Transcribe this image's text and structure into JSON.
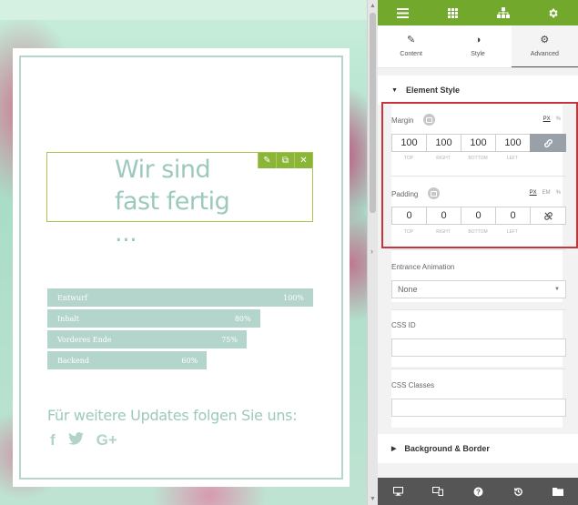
{
  "preview": {
    "heading": "Wir sind fast fertig ...",
    "bars": [
      {
        "label": "Entwurf",
        "percent_label": "100%",
        "value": 100
      },
      {
        "label": "Inhalt",
        "percent_label": "80%",
        "value": 80
      },
      {
        "label": "Vorderes Ende",
        "percent_label": "75%",
        "value": 75
      },
      {
        "label": "Backend",
        "percent_label": "60%",
        "value": 60
      }
    ],
    "follow_text": "Für weitere Updates folgen Sie uns:",
    "social_icons": [
      {
        "name": "facebook-icon",
        "glyph": "f"
      },
      {
        "name": "twitter-icon",
        "glyph": "🐦"
      },
      {
        "name": "google-plus-icon",
        "glyph": "G+"
      }
    ],
    "widget_tools": [
      {
        "name": "edit-icon",
        "glyph": "✎"
      },
      {
        "name": "duplicate-icon",
        "glyph": "⧉"
      },
      {
        "name": "remove-icon",
        "glyph": "✕"
      }
    ],
    "colors": {
      "accent_green": "#72a82b",
      "text_teal": "#9cc9bd",
      "bar_fill": "#b3d5cb"
    }
  },
  "panel": {
    "tabs": [
      {
        "label": "Content",
        "icon": "pencil-icon",
        "glyph": "✎"
      },
      {
        "label": "Style",
        "icon": "contrast-icon",
        "glyph": "◑"
      },
      {
        "label": "Advanced",
        "icon": "gear-icon",
        "glyph": "⚙"
      }
    ],
    "active_tab": "Advanced",
    "element_style": {
      "title": "Element Style",
      "margin": {
        "label": "Margin",
        "units": [
          "PX",
          "%"
        ],
        "values": [
          "100",
          "100",
          "100",
          "100"
        ],
        "captions": [
          "TOP",
          "RIGHT",
          "BOTTOM",
          "LEFT"
        ],
        "linked": true
      },
      "padding": {
        "label": "Padding",
        "units": [
          "PX",
          "EM",
          "%"
        ],
        "values": [
          "0",
          "0",
          "0",
          "0"
        ],
        "captions": [
          "TOP",
          "RIGHT",
          "BOTTOM",
          "LEFT"
        ],
        "linked": false
      },
      "entrance_animation": {
        "label": "Entrance Animation",
        "value": "None"
      },
      "css_id": {
        "label": "CSS ID",
        "value": ""
      },
      "css_classes": {
        "label": "CSS Classes",
        "value": ""
      }
    },
    "background_border": {
      "title": "Background & Border"
    },
    "highlight_color": "#c9333c"
  }
}
